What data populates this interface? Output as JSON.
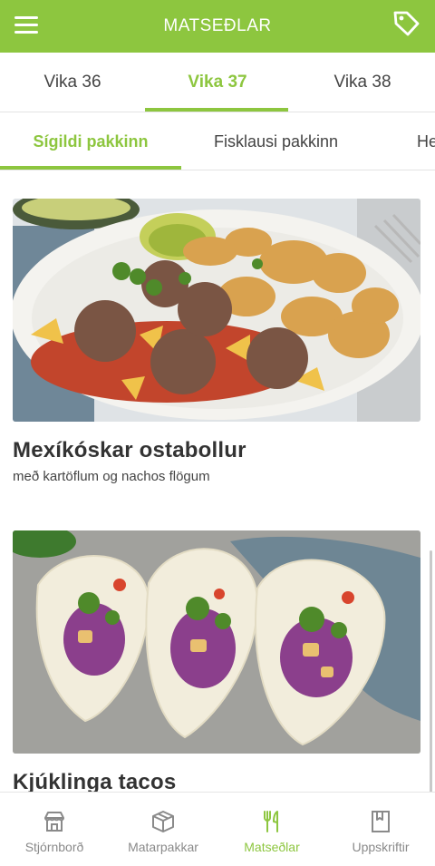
{
  "header": {
    "title": "MATSEÐLAR",
    "menu_icon": "hamburger-menu-icon",
    "tag_icon": "price-tag-icon",
    "accent_color": "#8dc63f"
  },
  "weeks": [
    {
      "label": "Vika 36",
      "active": false
    },
    {
      "label": "Vika 37",
      "active": true
    },
    {
      "label": "Vika 38",
      "active": false
    }
  ],
  "packages": [
    {
      "label": "Sígildi pakkinn",
      "active": true
    },
    {
      "label": "Fisklausi pakkinn",
      "active": false
    },
    {
      "label": "He",
      "active": false
    }
  ],
  "recipes": [
    {
      "title": "Mexíkóskar ostabollur",
      "subtitle": "með kartöflum og nachos flögum",
      "image": "meatballs-with-potatoes-photo"
    },
    {
      "title": "Kjúklinga tacos",
      "subtitle": "",
      "image": "chicken-tacos-photo"
    }
  ],
  "bottom_nav": [
    {
      "label": "Stjórnborð",
      "icon": "storefront-icon",
      "active": false
    },
    {
      "label": "Matarpakkar",
      "icon": "package-box-icon",
      "active": false
    },
    {
      "label": "Matseðlar",
      "icon": "fork-knife-icon",
      "active": true
    },
    {
      "label": "Uppskriftir",
      "icon": "bookmark-book-icon",
      "active": false
    }
  ]
}
